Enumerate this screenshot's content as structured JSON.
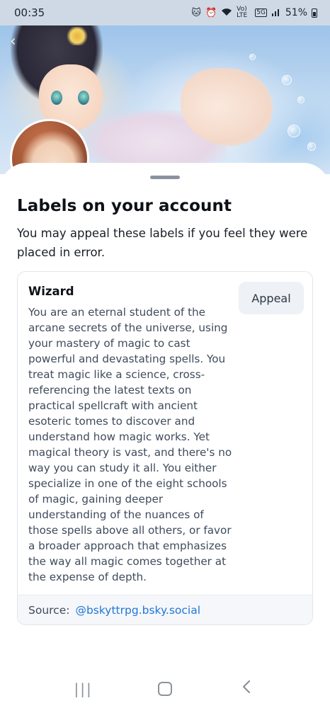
{
  "status_bar": {
    "time": "00:35",
    "network_label": "Vo) LTE",
    "signal_label": "5G",
    "battery_percent": "51%"
  },
  "banner": {
    "description_icon": "anime-illustration-banner"
  },
  "sheet": {
    "title": "Labels on your account",
    "subtitle": "You may appeal these labels if you feel they were placed in error."
  },
  "label": {
    "name": "Wizard",
    "appeal_label": "Appeal",
    "description": "You are an eternal student of the arcane secrets of the universe, using your mastery of magic to cast powerful and devastating spells. You treat magic like a science, cross-referencing the latest texts on practical spellcraft with ancient esoteric tomes to discover and understand how magic works. Yet magical theory is vast, and there's no way you can study it all. You either specialize in one of the eight schools of magic, gaining deeper understanding of the nuances of those spells above all others, or favor a broader approach that emphasizes the way all magic comes together at the expense of depth.",
    "source_prefix": "Source:",
    "source_handle": "@bskyttrpg.bsky.social"
  },
  "colors": {
    "link": "#2177d6",
    "card_border": "#e1e6ec",
    "source_bar_bg": "#f5f7fa",
    "appeal_bg": "#eef1f5"
  }
}
